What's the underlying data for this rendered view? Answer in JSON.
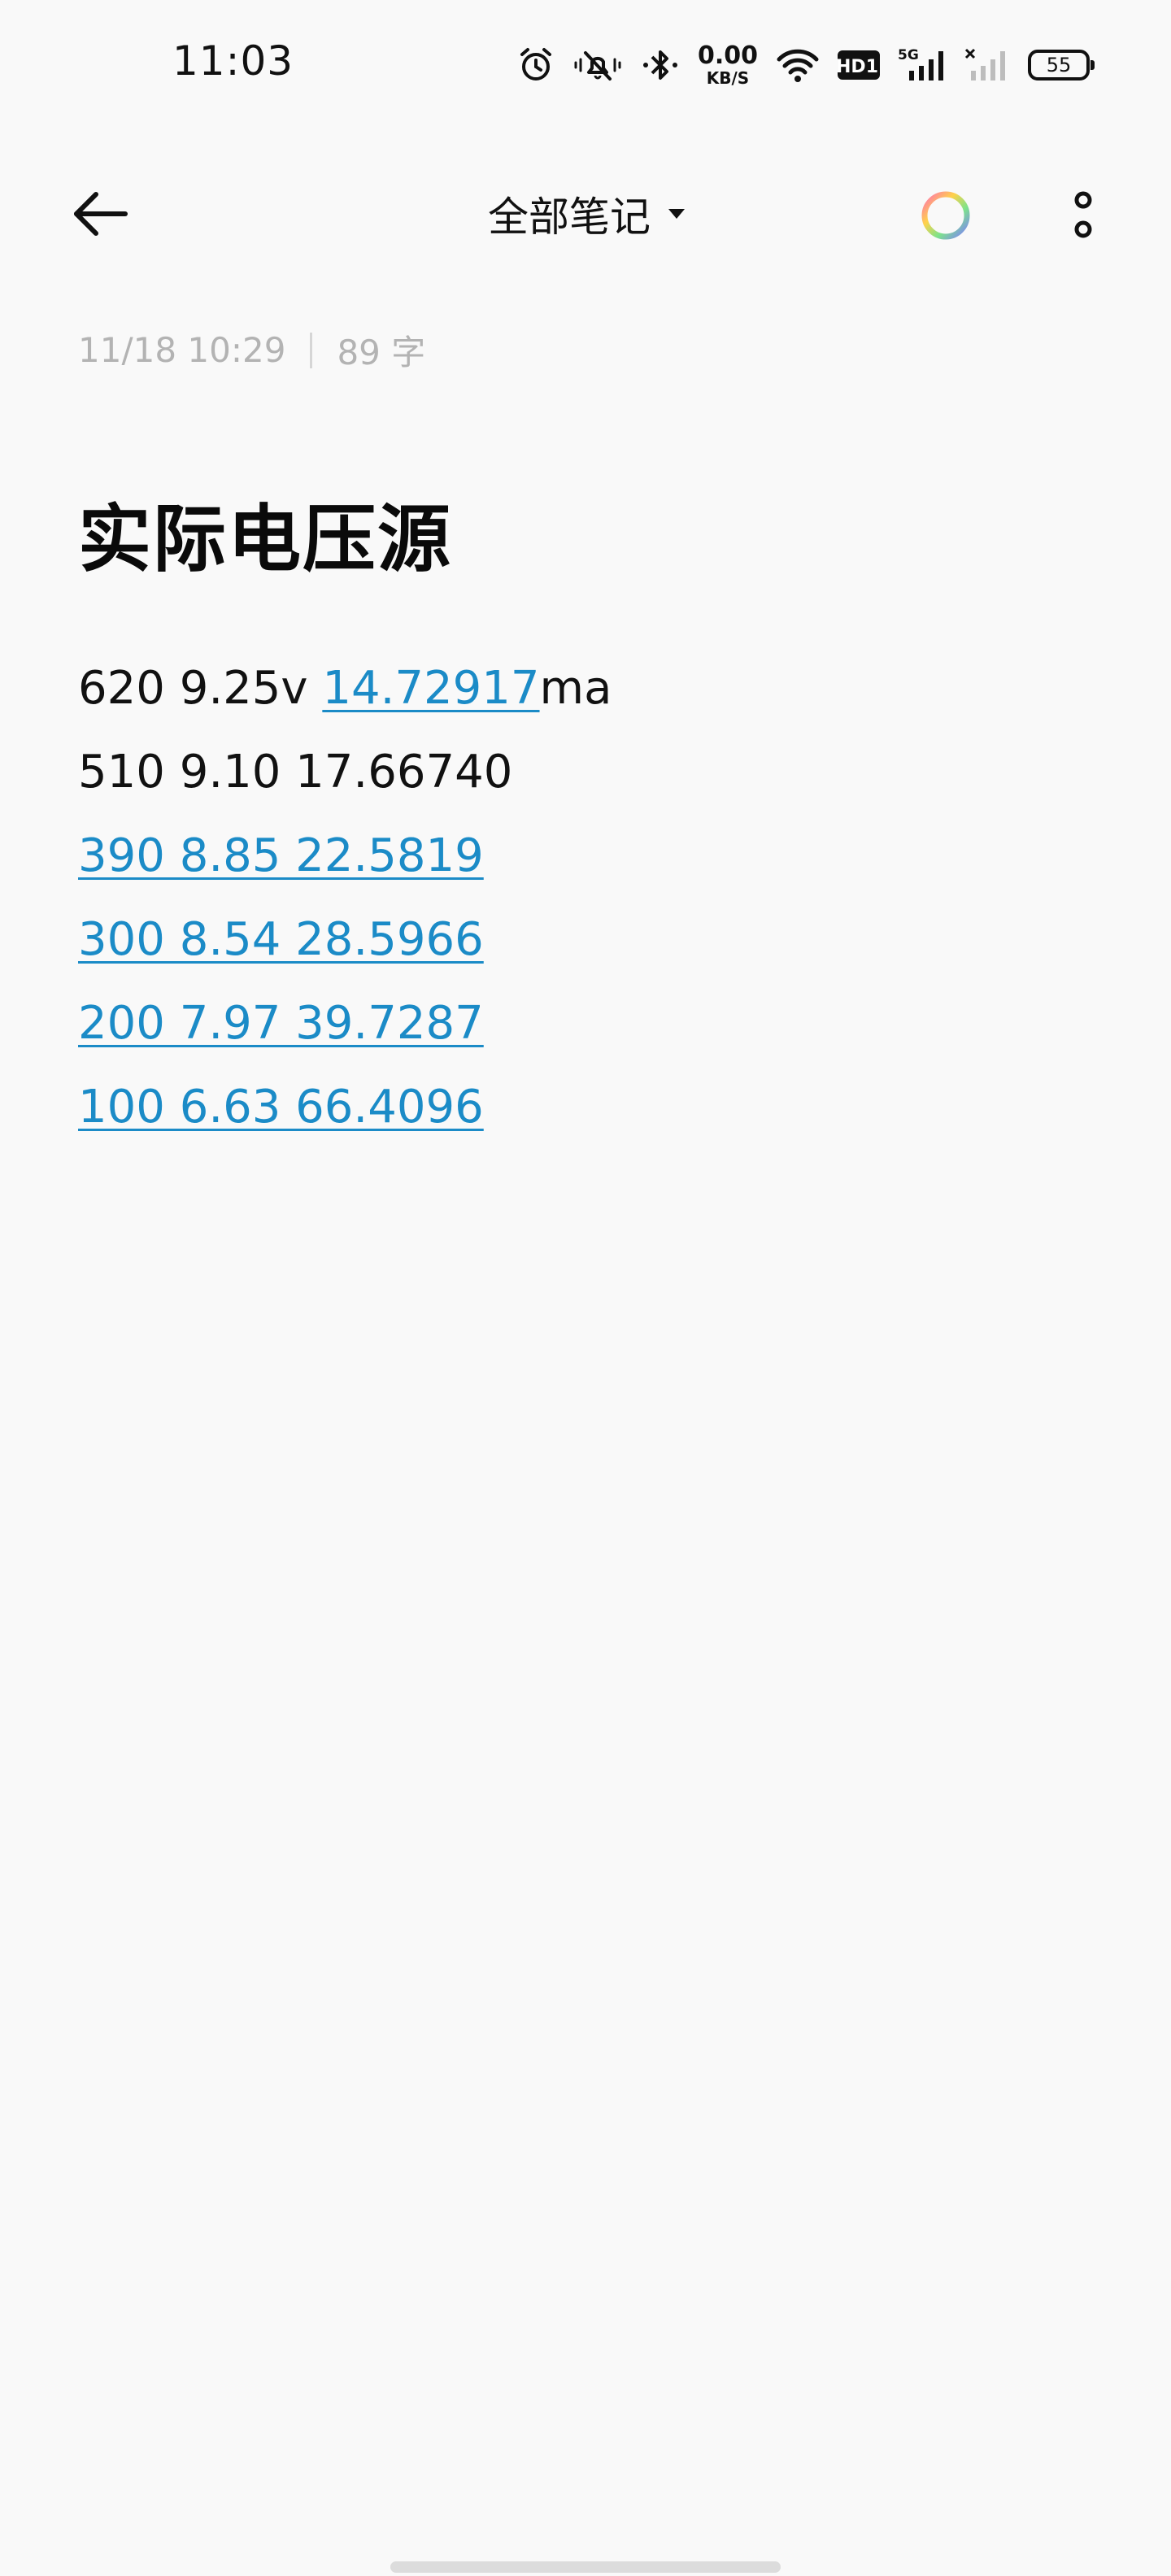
{
  "status_bar": {
    "time": "11:03",
    "net_speed_value": "0.00",
    "net_speed_unit": "KB/S",
    "hd_badge": "HD1",
    "signal_label": "5G",
    "battery": "55",
    "icons": [
      "alarm-icon",
      "mute-icon",
      "bluetooth-icon",
      "wifi-icon",
      "signal-5g-icon",
      "signal-no-sim-icon",
      "battery-icon"
    ]
  },
  "toolbar": {
    "title": "全部笔记",
    "icons": [
      "back-arrow-icon",
      "dropdown-caret-icon",
      "color-ring-icon",
      "more-vertical-icon"
    ]
  },
  "note": {
    "date": "11/18 10:29",
    "word_count": "89 字",
    "title": "实际电压源",
    "lines": [
      {
        "plain_prefix": "620 9.25v ",
        "link": "14.72917",
        "plain_suffix": "ma"
      },
      {
        "plain_prefix": "510 9.10 17.66740",
        "link": "",
        "plain_suffix": ""
      },
      {
        "plain_prefix": "",
        "link": "390 8.85 22.5819",
        "plain_suffix": ""
      },
      {
        "plain_prefix": "",
        "link": "300 8.54 28.5966",
        "plain_suffix": ""
      },
      {
        "plain_prefix": "",
        "link": "200 7.97 39.7287",
        "plain_suffix": ""
      },
      {
        "plain_prefix": "",
        "link": "100 6.63 66.4096",
        "plain_suffix": ""
      }
    ]
  },
  "colors": {
    "background": "#f9f9f9",
    "text": "#111111",
    "meta_text": "#b3b3b3",
    "link": "#1b8bc7"
  }
}
